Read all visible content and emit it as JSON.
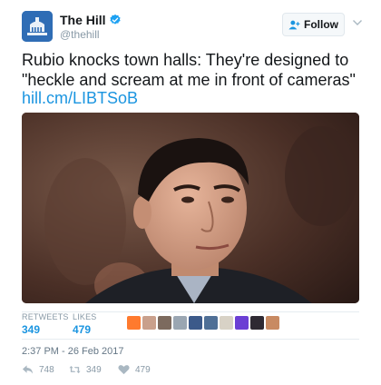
{
  "account": {
    "display_name": "The Hill",
    "handle": "@thehill",
    "avatar_text": "THE HILL",
    "verified_icon": "verified-badge-icon"
  },
  "follow": {
    "label": "Follow",
    "icon": "add-user-icon"
  },
  "tweet": {
    "text": "Rubio knocks town halls: They're designed to \"heckle and scream at me in front of cameras\"",
    "link": "hill.cm/LIBTSoB"
  },
  "stats": {
    "retweets_label": "RETWEETS",
    "retweets_value": "349",
    "likes_label": "LIKES",
    "likes_value": "479"
  },
  "timestamp": "2:37 PM - 26 Feb 2017",
  "actions": {
    "reply_count": "748",
    "retweet_count": "349",
    "like_count": "479"
  },
  "colors": {
    "link": "#1b95e0",
    "muted": "#8899a6",
    "verified": "#1da1f2"
  }
}
